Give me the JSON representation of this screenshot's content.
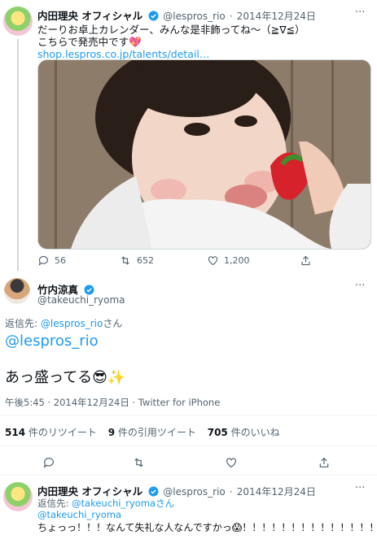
{
  "tweet1": {
    "display_name": "内田理央 オフィシャル",
    "handle": "@lespros_rio",
    "date": "2014年12月24日",
    "line1": "だーりお卓上カレンダー、みんな是非飾ってね〜（≧∇≦）",
    "line2": "こちらで発売中です💖",
    "url": "shop.lespros.co.jp/talents/detail…",
    "replies": "56",
    "retweets": "652",
    "likes": "1,200"
  },
  "main_tweet": {
    "display_name": "竹内涼真",
    "handle": "@takeuchi_ryoma",
    "reply_to_prefix": "返信先: ",
    "reply_to_handle": "@lespros_rio",
    "reply_to_suffix": "さん",
    "mention": "@lespros_rio",
    "text": "あっ盛ってる😎✨",
    "timestamp": "午後5:45 · 2014年12月24日 · Twitter for iPhone",
    "retweet_count": "514",
    "retweet_label": " 件のリツイート",
    "quote_count": "9",
    "quote_label": " 件の引用ツイート",
    "like_count": "705",
    "like_label": " 件のいいね"
  },
  "reply_tweet": {
    "display_name": "内田理央 オフィシャル",
    "handle": "@lespros_rio",
    "date": "2014年12月24日",
    "reply_to_prefix": "返信先: ",
    "reply_to_handle": "@takeuchi_ryomaさん",
    "mention": "@takeuchi_ryoma",
    "text": "ちょっっ！！！なんて失礼な人なんですかっ😱！！！！！！！！！！！！！！！"
  },
  "colors": {
    "accent": "#1d9bf0",
    "muted": "#536471",
    "text": "#0f1419",
    "verified": "#1d9bf0"
  },
  "icons": [
    "verified-badge-icon",
    "more-icon",
    "reply-icon",
    "retweet-icon",
    "like-icon",
    "share-icon"
  ]
}
